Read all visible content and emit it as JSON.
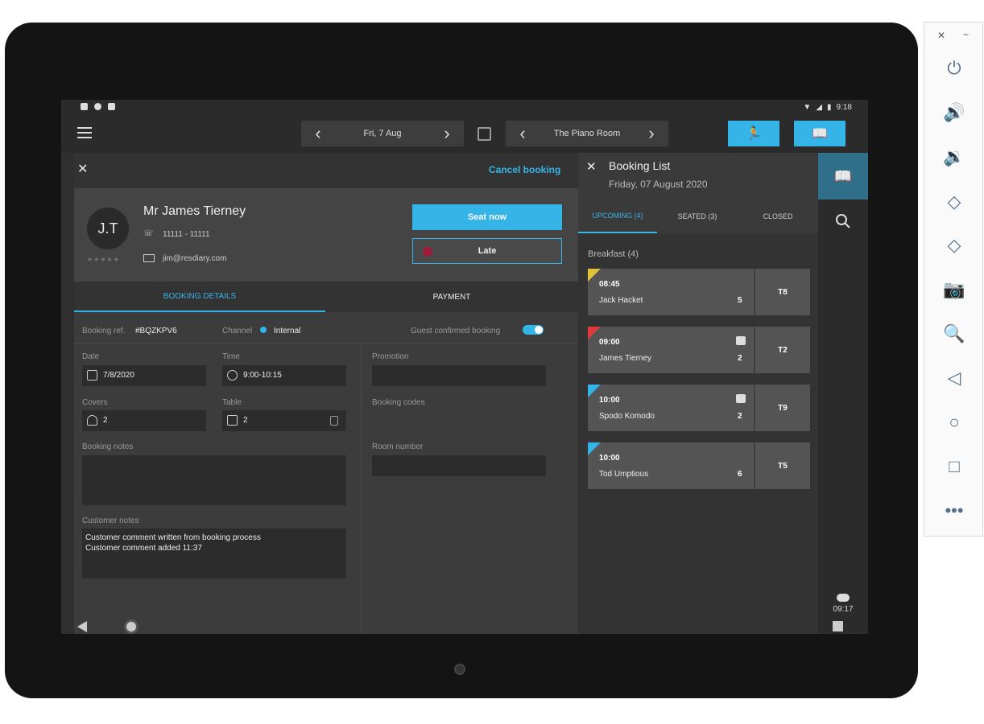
{
  "status_bar": {
    "time": "9:18"
  },
  "app_bar": {
    "date_label": "Fri, 7 Aug",
    "room_label": "The Piano Room"
  },
  "booking": {
    "cancel_label": "Cancel booking",
    "guest_initials": "J.T",
    "guest_name": "Mr James Tierney",
    "guest_phone": "11111 - 11111",
    "guest_email": "jim@resdiary.com",
    "seat_now_label": "Seat now",
    "late_label": "Late",
    "tabs": [
      "BOOKING DETAILS",
      "PAYMENT"
    ],
    "ref_label": "Booking ref.",
    "ref_value": "#BQZKPV6",
    "channel_label": "Channel",
    "channel_value": "Internal",
    "guest_confirmed_label": "Guest confirmed booking",
    "date_label": "Date",
    "date_value": "7/8/2020",
    "time_label": "Time",
    "time_value": "9:00-10:15",
    "covers_label": "Covers",
    "covers_value": "2",
    "table_label": "Table",
    "table_value": "2",
    "promotion_label": "Promotion",
    "booking_codes_label": "Booking codes",
    "room_number_label": "Room number",
    "booking_notes_label": "Booking notes",
    "customer_notes_label": "Customer notes",
    "customer_notes_lines": [
      "Customer comment written from booking process",
      "Customer comment added 11:37"
    ]
  },
  "booking_list": {
    "title": "Booking List",
    "date": "Friday, 07 August 2020",
    "tabs": [
      "UPCOMING (4)",
      "SEATED (3)",
      "CLOSED"
    ],
    "section": "Breakfast (4)",
    "cards": [
      {
        "time": "08:45",
        "name": "Jack Hacket",
        "covers": "5",
        "table": "T8",
        "flag_color": "#e0c33a"
      },
      {
        "time": "09:00",
        "name": "James Tierney",
        "covers": "2",
        "table": "T2",
        "flag_color": "#e03a3a"
      },
      {
        "time": "10:00",
        "name": "Spodo Komodo",
        "covers": "2",
        "table": "T9",
        "flag_color": "#35b4e8"
      },
      {
        "time": "10:00",
        "name": "Tod Umptious",
        "covers": "6",
        "table": "T5",
        "flag_color": "#35b4e8"
      }
    ]
  },
  "rail": {
    "sync_time": "09:17"
  },
  "colors": {
    "accent": "#35b4e8",
    "panel": "#3c3c3c"
  }
}
